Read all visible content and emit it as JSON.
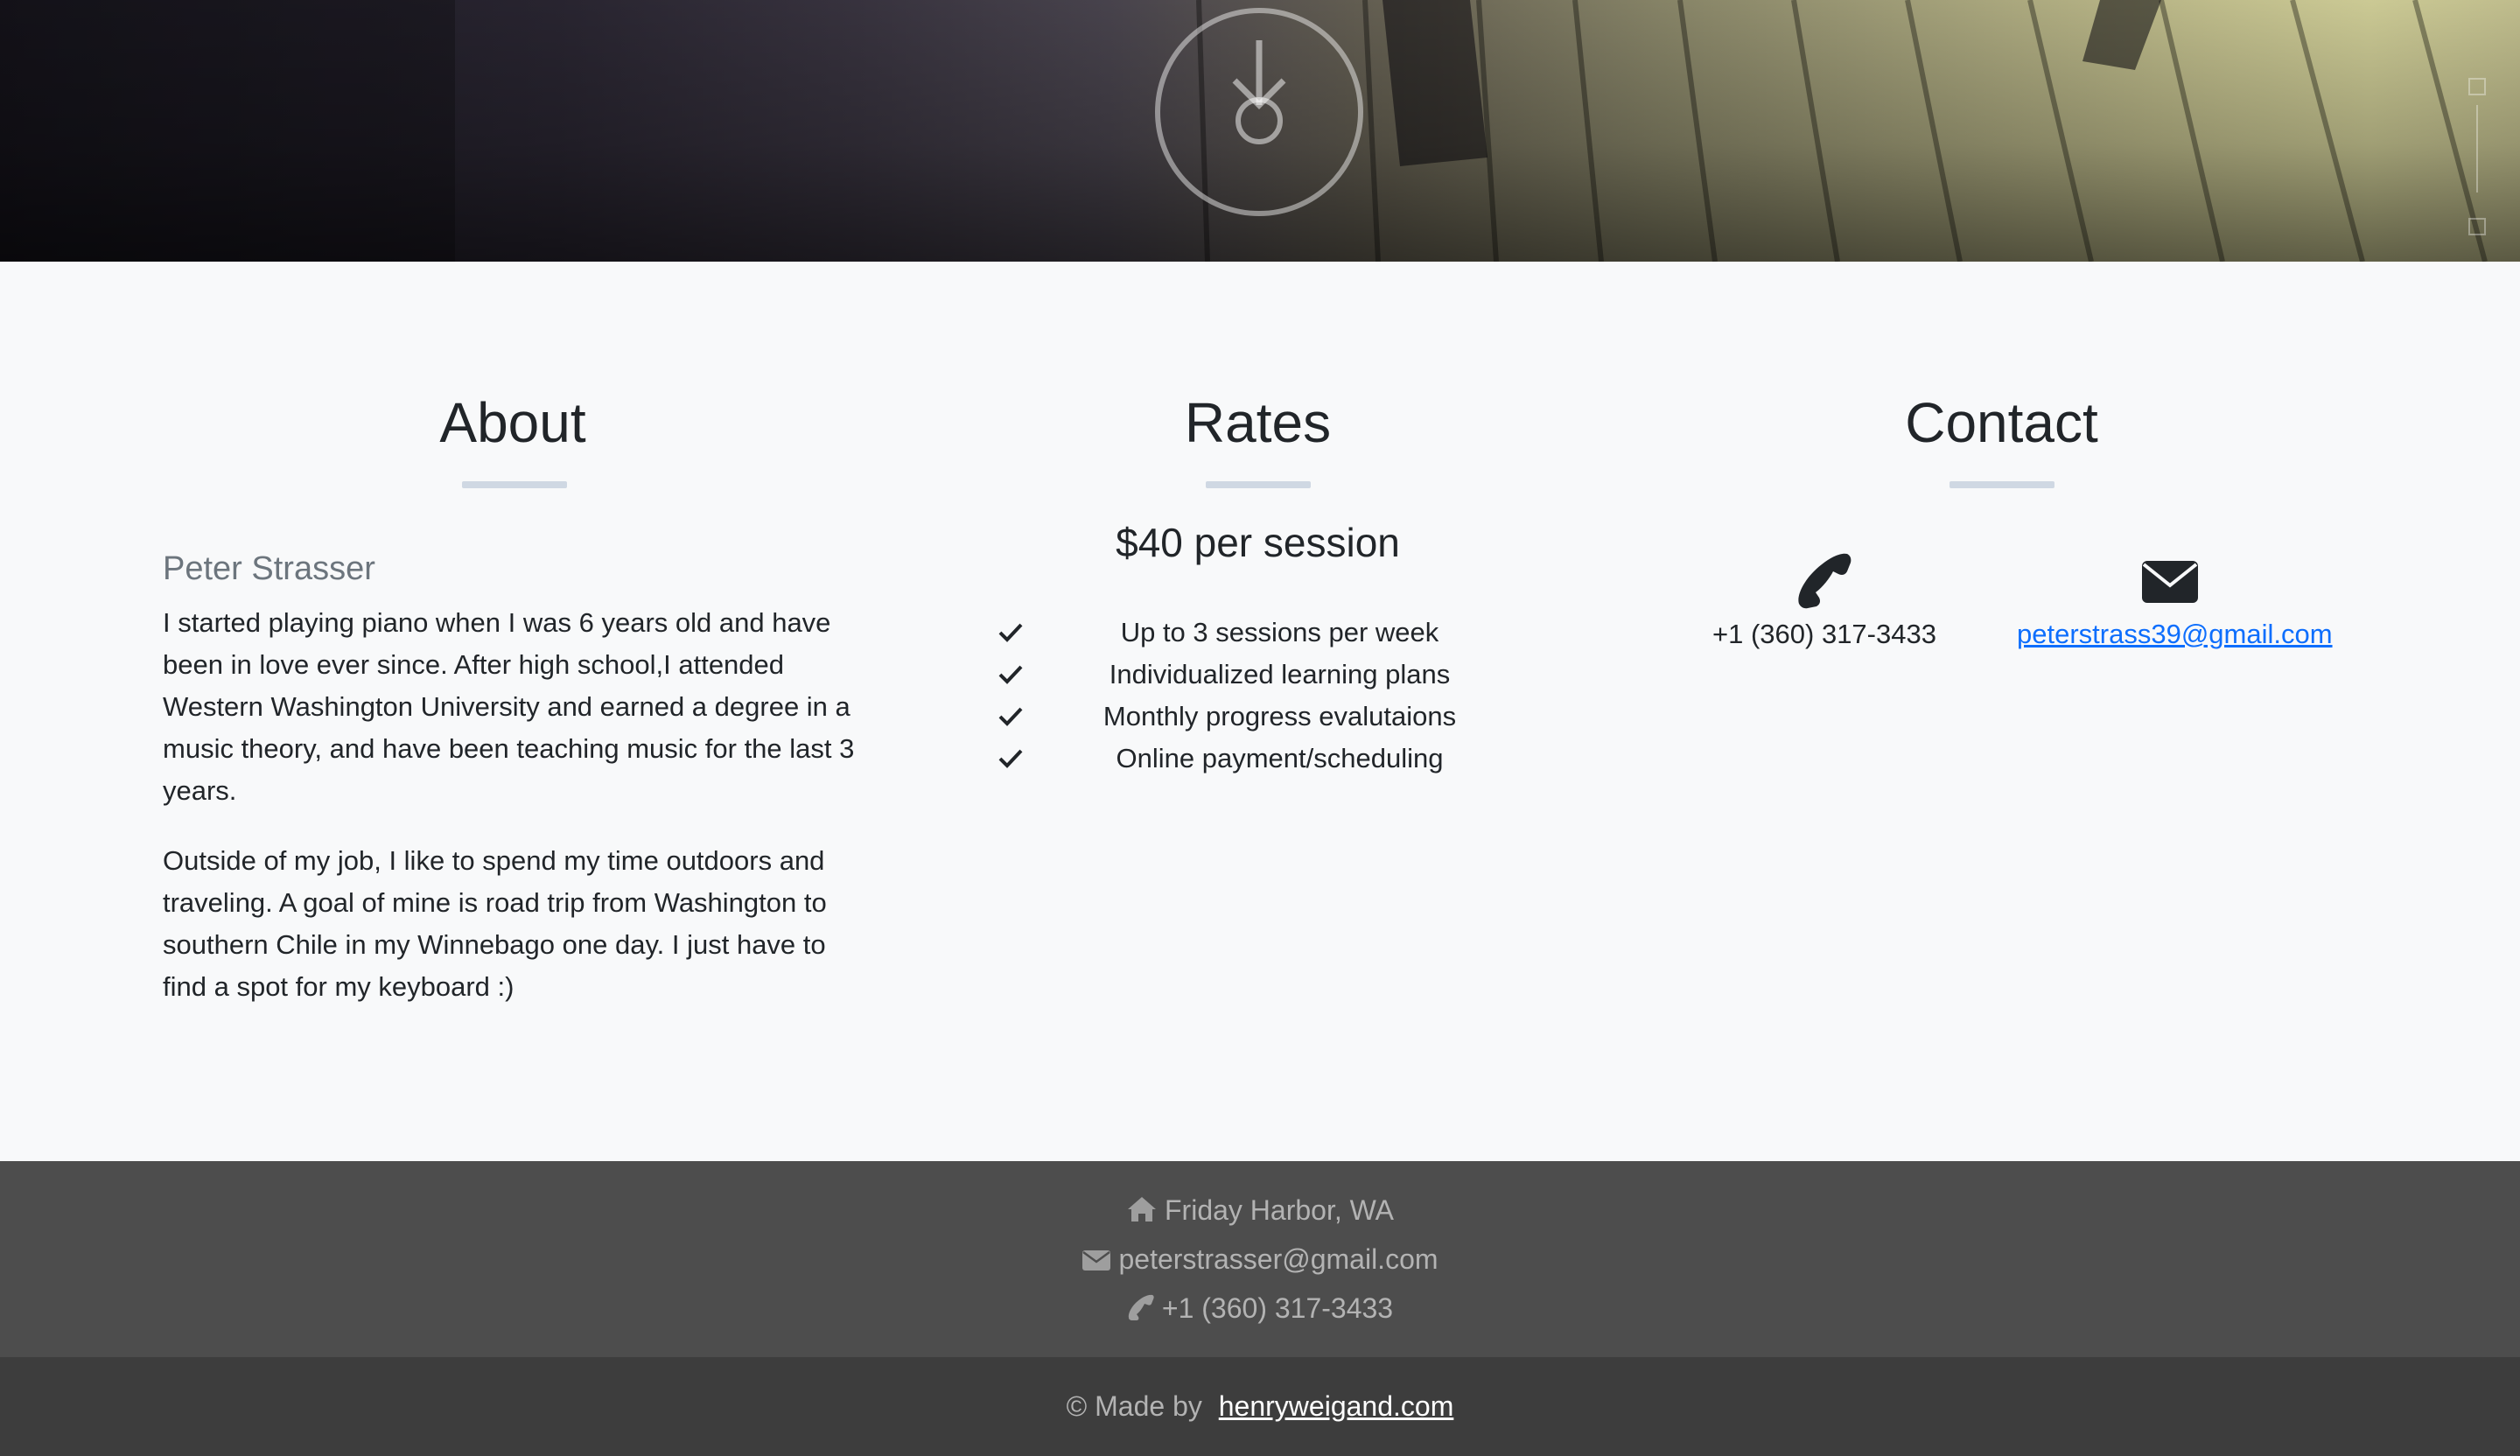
{
  "hero": {
    "scroll_icon": "arrow-down-circle-icon",
    "side_icons": [
      "side-nav-icon",
      "side-nav-icon"
    ]
  },
  "about": {
    "title": "About",
    "name": "Peter Strasser",
    "paragraph1": "I started playing piano when I was 6 years old and have been in love ever since. After high school,I attended Western Washington University and earned a degree in a music theory, and have been teaching music for the last 3 years.",
    "paragraph2": "Outside of my job, I like to spend my time outdoors and traveling. A goal of mine is road trip from Washington to southern Chile in my Winnebago one day. I just have to find a spot for my keyboard :)"
  },
  "rates": {
    "title": "Rates",
    "price": "$40 per session",
    "items": [
      "Up to 3 sessions per week",
      "Individualized learning plans",
      "Monthly progress evalutaions",
      "Online payment/scheduling"
    ],
    "item_icon": "check-icon"
  },
  "contact": {
    "title": "Contact",
    "phone": "+1 (360) 317-3433",
    "email": "peterstrass39@gmail.com",
    "phone_icon": "phone-icon",
    "email_icon": "envelope-icon"
  },
  "footer": {
    "location": "Friday Harbor, WA",
    "email": "peterstrasser@gmail.com",
    "phone": "+1 (360) 317-3433",
    "made_by_prefix": "© Made by",
    "made_by_link": "henryweigand.com"
  },
  "colors": {
    "background": "#f8f9fa",
    "text": "#212529",
    "muted": "#6c757d",
    "link": "#0d6efd",
    "title_rule": "#cfd8e3",
    "footer_info_bg": "#4d4d4d",
    "footer_bottom_bg": "#3d3d3d"
  }
}
